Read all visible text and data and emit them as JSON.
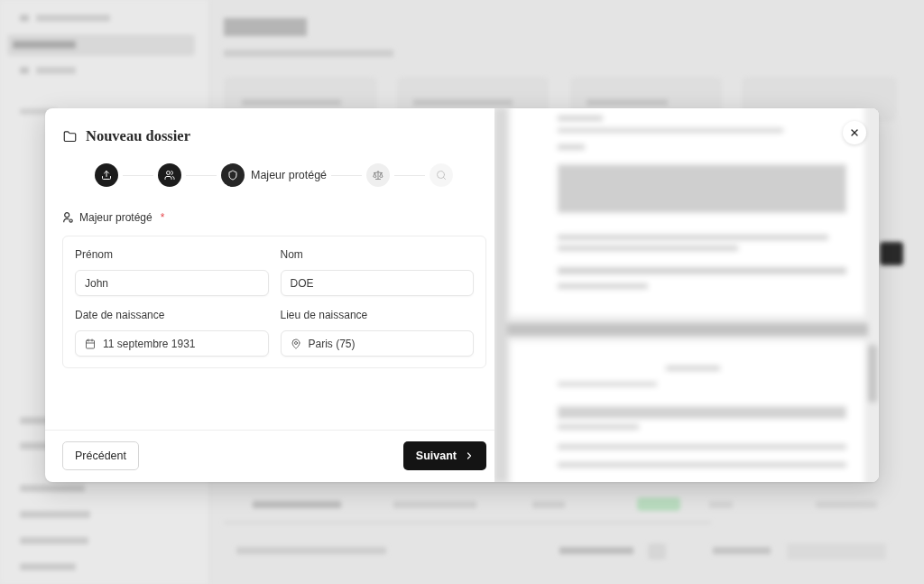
{
  "dialog": {
    "title": "Nouveau dossier",
    "steps": [
      {
        "completed": true,
        "current": false,
        "disabled": false
      },
      {
        "completed": true,
        "current": false,
        "disabled": false
      },
      {
        "completed": false,
        "current": true,
        "disabled": false,
        "label": "Majeur protégé"
      },
      {
        "completed": false,
        "current": false,
        "disabled": false
      },
      {
        "completed": false,
        "current": false,
        "disabled": true
      }
    ],
    "section": {
      "label": "Majeur protégé",
      "required_mark": "*"
    },
    "fields": [
      {
        "label": "Prénom",
        "value": "John",
        "kind": "text"
      },
      {
        "label": "Nom",
        "value": "DOE",
        "kind": "text"
      },
      {
        "label": "Date de naissance",
        "value": "11 septembre 1931",
        "kind": "date"
      },
      {
        "label": "Lieu de naissance",
        "value": "Paris (75)",
        "kind": "place"
      }
    ],
    "footer": {
      "back_button": "Précédent",
      "next_button": "Suivant"
    }
  }
}
